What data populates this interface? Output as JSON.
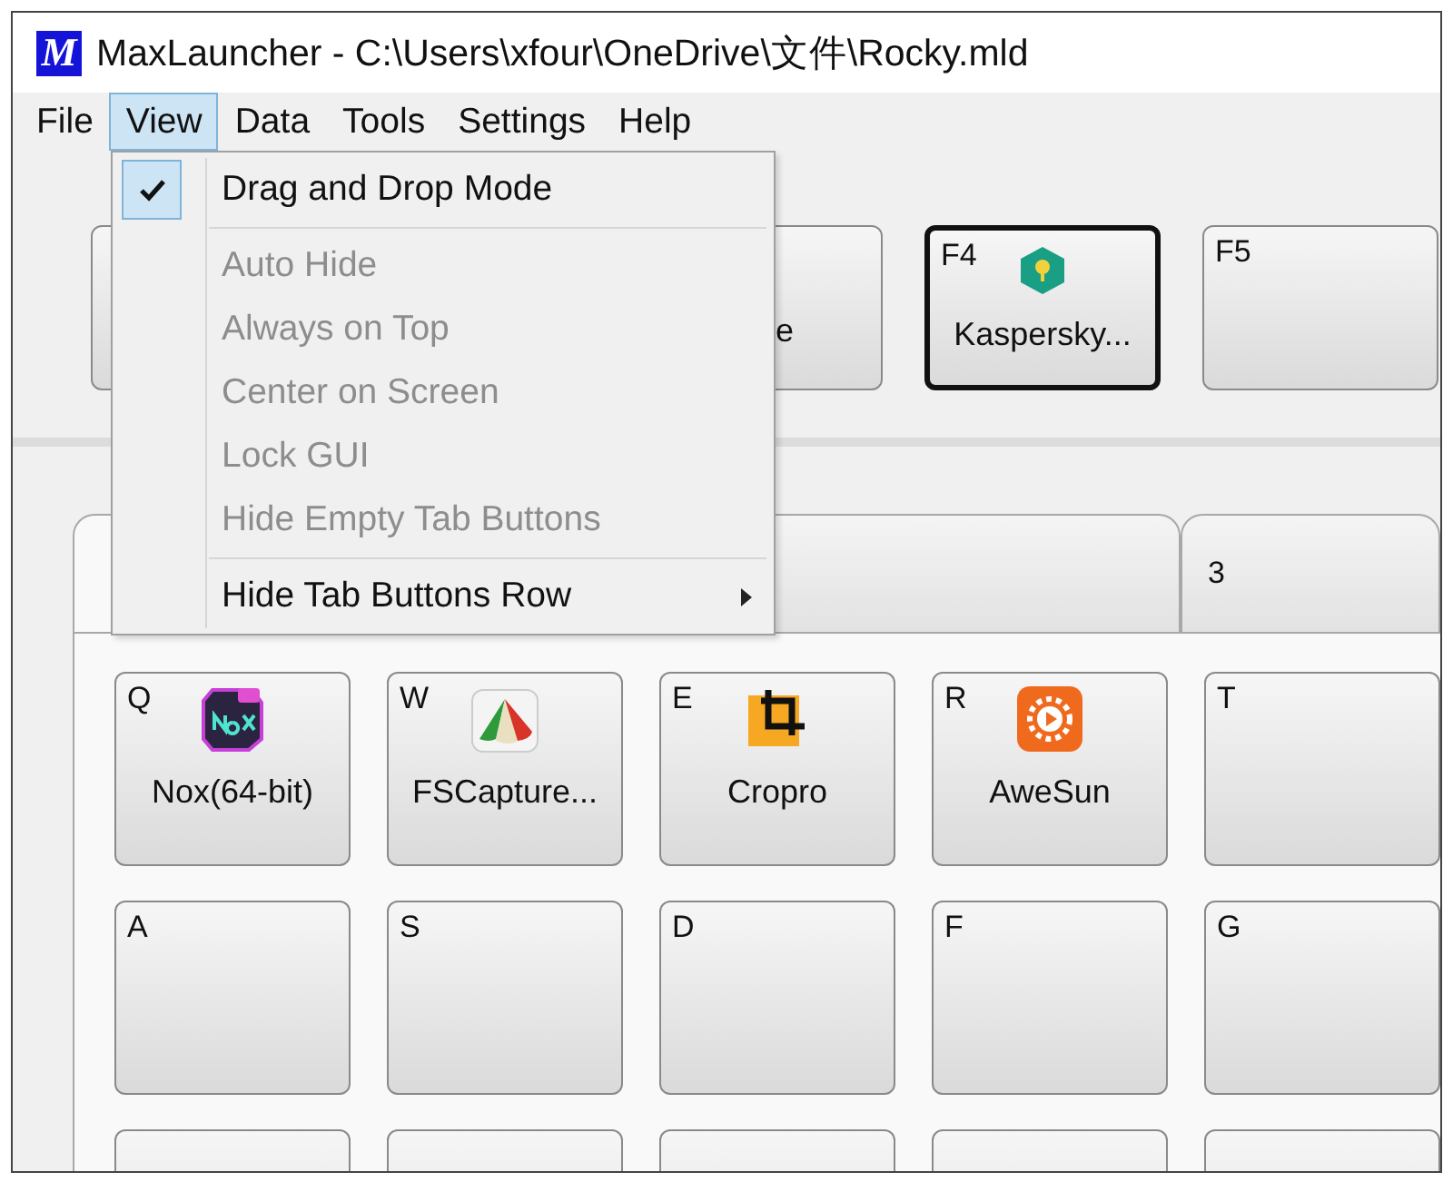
{
  "window": {
    "app_icon": "M",
    "title": "MaxLauncher - C:\\Users\\xfour\\OneDrive\\文件\\Rocky.mld"
  },
  "menu_bar": [
    {
      "label": "File",
      "selected": false
    },
    {
      "label": "View",
      "selected": true
    },
    {
      "label": "Data",
      "selected": false
    },
    {
      "label": "Tools",
      "selected": false
    },
    {
      "label": "Settings",
      "selected": false
    },
    {
      "label": "Help",
      "selected": false
    }
  ],
  "view_menu": [
    {
      "kind": "item",
      "label": "Drag and Drop Mode",
      "checked": true,
      "disabled": false
    },
    {
      "kind": "separator"
    },
    {
      "kind": "item",
      "label": "Auto Hide",
      "checked": false,
      "disabled": true
    },
    {
      "kind": "item",
      "label": "Always on Top",
      "checked": false,
      "disabled": true
    },
    {
      "kind": "item",
      "label": "Center on Screen",
      "checked": false,
      "disabled": true
    },
    {
      "kind": "item",
      "label": "Lock GUI",
      "checked": false,
      "disabled": true
    },
    {
      "kind": "item",
      "label": "Hide Empty Tab Buttons",
      "checked": false,
      "disabled": true
    },
    {
      "kind": "separator"
    },
    {
      "kind": "submenu",
      "label": "Hide Tab Buttons Row",
      "checked": false,
      "disabled": false
    }
  ],
  "top_buttons": [
    {
      "label": "e",
      "selected": false
    },
    {
      "key": "F4",
      "kind": "hexagon",
      "label": "Kaspersky...",
      "selected": true
    },
    {
      "key": "F5",
      "selected": false
    }
  ],
  "tabs": [
    {
      "selected": true
    },
    {
      "selected": false
    },
    {
      "label": "3",
      "selected": false
    }
  ],
  "grid": [
    [
      {
        "key": "Q",
        "kind": "nox",
        "label": "Nox(64-bit)"
      },
      {
        "key": "W",
        "kind": "fan",
        "label": "FSCapture..."
      },
      {
        "key": "E",
        "kind": "crop",
        "label": "Cropro"
      },
      {
        "key": "R",
        "kind": "sun",
        "label": "AweSun"
      },
      {
        "key": "T"
      }
    ],
    [
      {
        "key": "A"
      },
      {
        "key": "S"
      },
      {
        "key": "D"
      },
      {
        "key": "F"
      },
      {
        "key": "G"
      }
    ]
  ]
}
